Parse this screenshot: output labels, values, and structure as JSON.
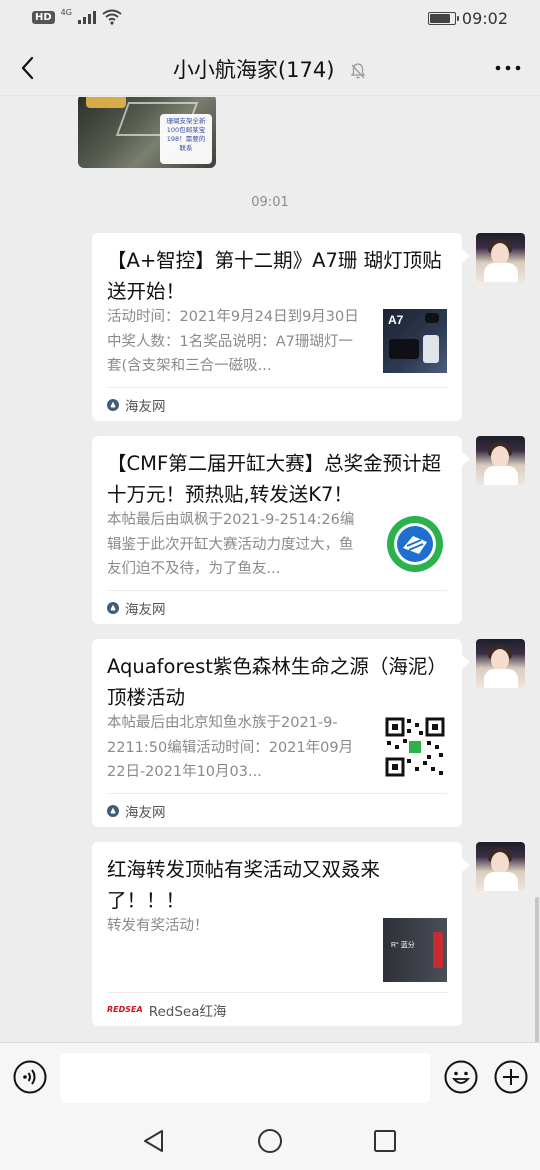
{
  "status_bar": {
    "hd_badge": "HD",
    "network": "4G",
    "time": "09:02",
    "battery_level": 0.85
  },
  "header": {
    "title": "小小航海家(174)",
    "back_icon": "chevron-left-icon",
    "mute_icon": "bell-off-icon",
    "more_icon": "more-dots-icon"
  },
  "chat": {
    "image_message": {
      "note_text": "珊瑚支架全新\n100包邮某宝\n198！需要的\n联系"
    },
    "timestamp": "09:01",
    "messages": [
      {
        "title": "【A+智控】第十二期》A7珊 瑚灯顶贴送开始！",
        "desc": "活动时间：2021年9月24日到9月30日中奖人数：1名奖品说明：A7珊瑚灯一套(含支架和三合一磁吸...",
        "thumb_label": "A7",
        "source": "海友网"
      },
      {
        "title": "【CMF第二届开缸大赛】总奖金预计超十万元！预热贴,转发送K7！",
        "desc": "本帖最后由飒枫于2021-9-2514:26编辑鉴于此次开缸大赛活动力度过大，鱼友们迫不及待，为了鱼友...",
        "source": "海友网"
      },
      {
        "title": "Aquaforest紫色森林生命之源（海泥）顶楼活动",
        "desc": "本帖最后由北京知鱼水族于2021-9-2211:50编辑活动时间：2021年09月22日-2021年10月03...",
        "source": "海友网"
      },
      {
        "title": "红海转发顶帖有奖活动又双叒来了！！！",
        "desc": "转发有奖活动！",
        "thumb_label": "R° 蓝分",
        "source_badge": "REDSEA",
        "source": "RedSea红海"
      }
    ]
  },
  "input_bar": {
    "value": "",
    "voice_icon": "voice-icon",
    "emoji_icon": "emoji-icon",
    "plus_icon": "plus-icon"
  },
  "nav_bar": {
    "back_icon": "nav-back-triangle-icon",
    "home_icon": "nav-home-circle-icon",
    "recents_icon": "nav-recents-square-icon"
  }
}
